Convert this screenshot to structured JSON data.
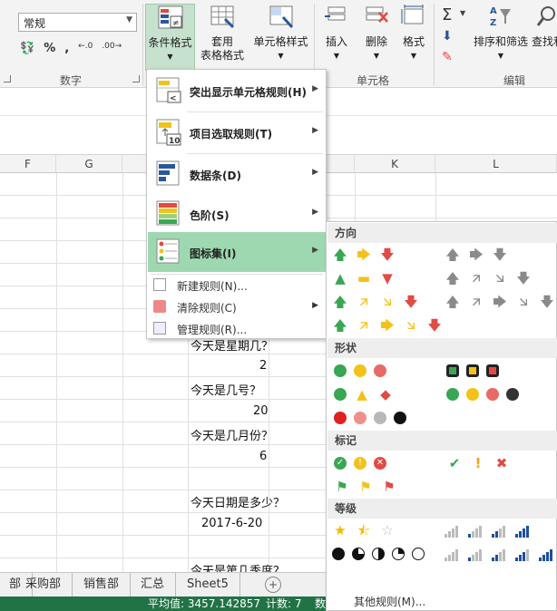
{
  "ribbon": {
    "number_format_value": "常规",
    "number_group_label": "数字",
    "cells_group_label": "单元格",
    "editing_group_label": "编辑",
    "buttons": {
      "conditional_format": "条件格式",
      "table_format_line1": "套用",
      "table_format_line2": "表格格式",
      "cell_styles": "单元格样式",
      "insert": "插入",
      "delete": "删除",
      "format": "格式",
      "sort_filter": "排序和筛选",
      "find_select": "查找和"
    },
    "number_icons": {
      "percent": "%",
      "comma": ",",
      "inc_decimal": "←.0",
      "dec_decimal": ".00→"
    }
  },
  "columns": [
    "F",
    "G",
    "",
    "",
    "",
    "K",
    "L"
  ],
  "cells": {
    "q1": "今天是星期几？",
    "a1": "2",
    "q2": "今天是几号？",
    "a2": "20",
    "q3": "今天是几月份？",
    "a3": "6",
    "q4": "今天日期是多少？",
    "a4": "2017-6-20",
    "q5": "今天是第几季度？"
  },
  "sheet_tabs": [
    "部",
    "采购部",
    "销售部",
    "汇总",
    "Sheet5"
  ],
  "status": {
    "average": "平均值: 3457.142857",
    "count": "计数: 7",
    "extra": "数"
  },
  "cf_menu": {
    "items": [
      {
        "label": "突出显示单元格规则(H)"
      },
      {
        "label": "项目选取规则(T)"
      },
      {
        "label": "数据条(D)"
      },
      {
        "label": "色阶(S)"
      },
      {
        "label": "图标集(I)"
      }
    ],
    "small_items": [
      {
        "label": "新建规则(N)..."
      },
      {
        "label": "清除规则(C)"
      },
      {
        "label": "管理规则(R)..."
      }
    ]
  },
  "iconset_menu": {
    "sections": {
      "direction": "方向",
      "shape": "形状",
      "marks": "标记",
      "rating": "等级"
    },
    "footer": "其他规则(M)..."
  },
  "colors": {
    "excel_green": "#217346",
    "hover_green": "#9ed8b1",
    "active_button": "#c6e1cd",
    "arrow_green": "#3aa655",
    "arrow_yellow": "#f2c21b",
    "arrow_red": "#e04b43",
    "arrow_gray": "#8a8a8a",
    "star_gold": "#f5b800",
    "rating_blue": "#1e4fa0"
  }
}
